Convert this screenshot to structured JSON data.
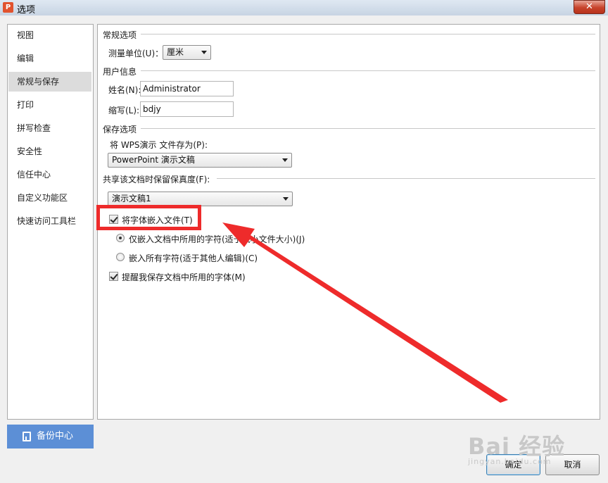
{
  "window": {
    "title": "选项",
    "close_glyph": "✕",
    "app_icon_glyph": "P"
  },
  "sidebar": {
    "items": [
      {
        "label": "视图"
      },
      {
        "label": "编辑"
      },
      {
        "label": "常规与保存",
        "active": true
      },
      {
        "label": "打印"
      },
      {
        "label": "拼写检查"
      },
      {
        "label": "安全性"
      },
      {
        "label": "信任中心"
      },
      {
        "label": "自定义功能区"
      },
      {
        "label": "快速访问工具栏"
      }
    ],
    "backup_label": "备份中心"
  },
  "general": {
    "title": "常规选项",
    "unit_label": "测量单位(U)：",
    "unit_value": "厘米"
  },
  "user_info": {
    "title": "用户信息",
    "name_label": "姓名(N):",
    "name_value": "Administrator",
    "initials_label": "缩写(L):",
    "initials_value": "bdjy"
  },
  "save_options": {
    "title": "保存选项",
    "save_as_label": "将 WPS演示 文件存为(P):",
    "save_as_value": "PowerPoint 演示文稿"
  },
  "fidelity": {
    "title": "共享该文档时保留保真度(F):",
    "document_value": "演示文稿1",
    "embed_fonts_label": "将字体嵌入文件(T)",
    "embed_fonts_checked": true,
    "embed_used_label": "仅嵌入文档中所用的字符(适于减小文件大小)(J)",
    "embed_used_selected": true,
    "embed_all_label": "嵌入所有字符(适于其他人编辑)(C)",
    "embed_all_selected": false,
    "remind_fonts_label": "提醒我保存文档中所用的字体(M)",
    "remind_fonts_checked": true
  },
  "buttons": {
    "ok": "确定",
    "cancel": "取消"
  },
  "watermark": {
    "main": "Bai 经验",
    "sub": "jingyan.baidu.com"
  },
  "colors": {
    "annotation_red": "#ee2b2b",
    "backup_blue": "#5c8fd6"
  }
}
